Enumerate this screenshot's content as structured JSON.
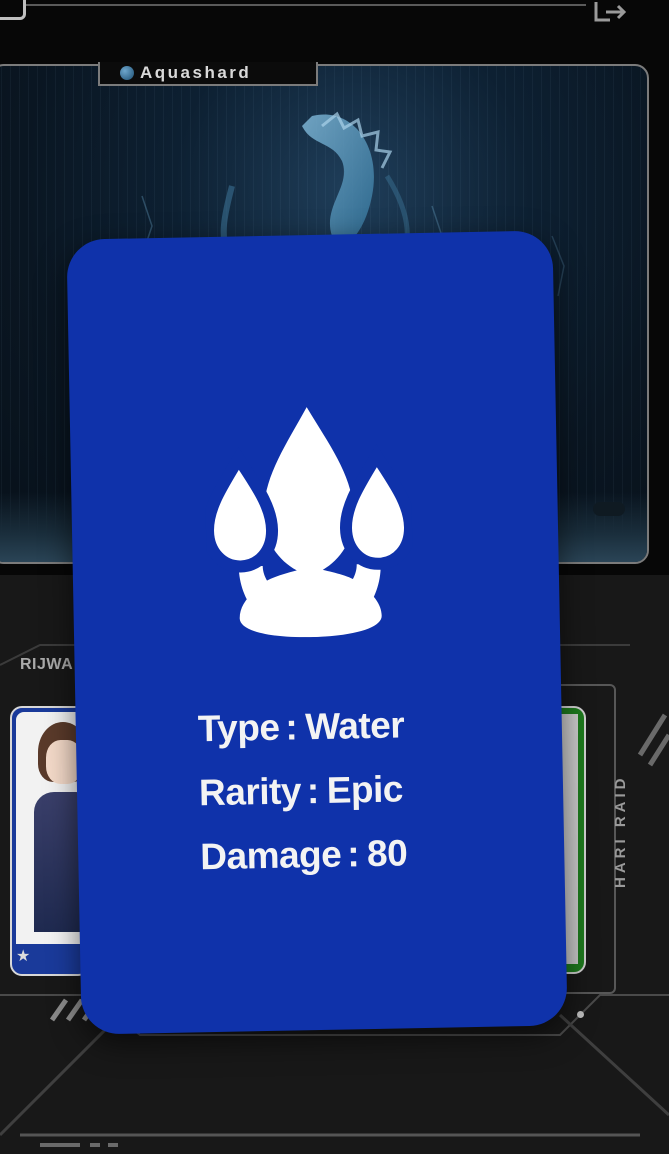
{
  "hero": {
    "name": "Aquashard"
  },
  "players": {
    "self_label": "RIJWA",
    "opponent_label": "HARI RAID"
  },
  "element_card": {
    "icon": "water-drops-icon",
    "color": "#0f32aa",
    "stats": [
      {
        "label": "Type",
        "value": "Water"
      },
      {
        "label": "Rarity",
        "value": "Epic"
      },
      {
        "label": "Damage",
        "value": "80"
      }
    ]
  },
  "colors": {
    "background": "#070707",
    "card_blue": "#0f32aa",
    "nature_green": "#1e7a1e",
    "text_light": "#f3f3f3"
  }
}
